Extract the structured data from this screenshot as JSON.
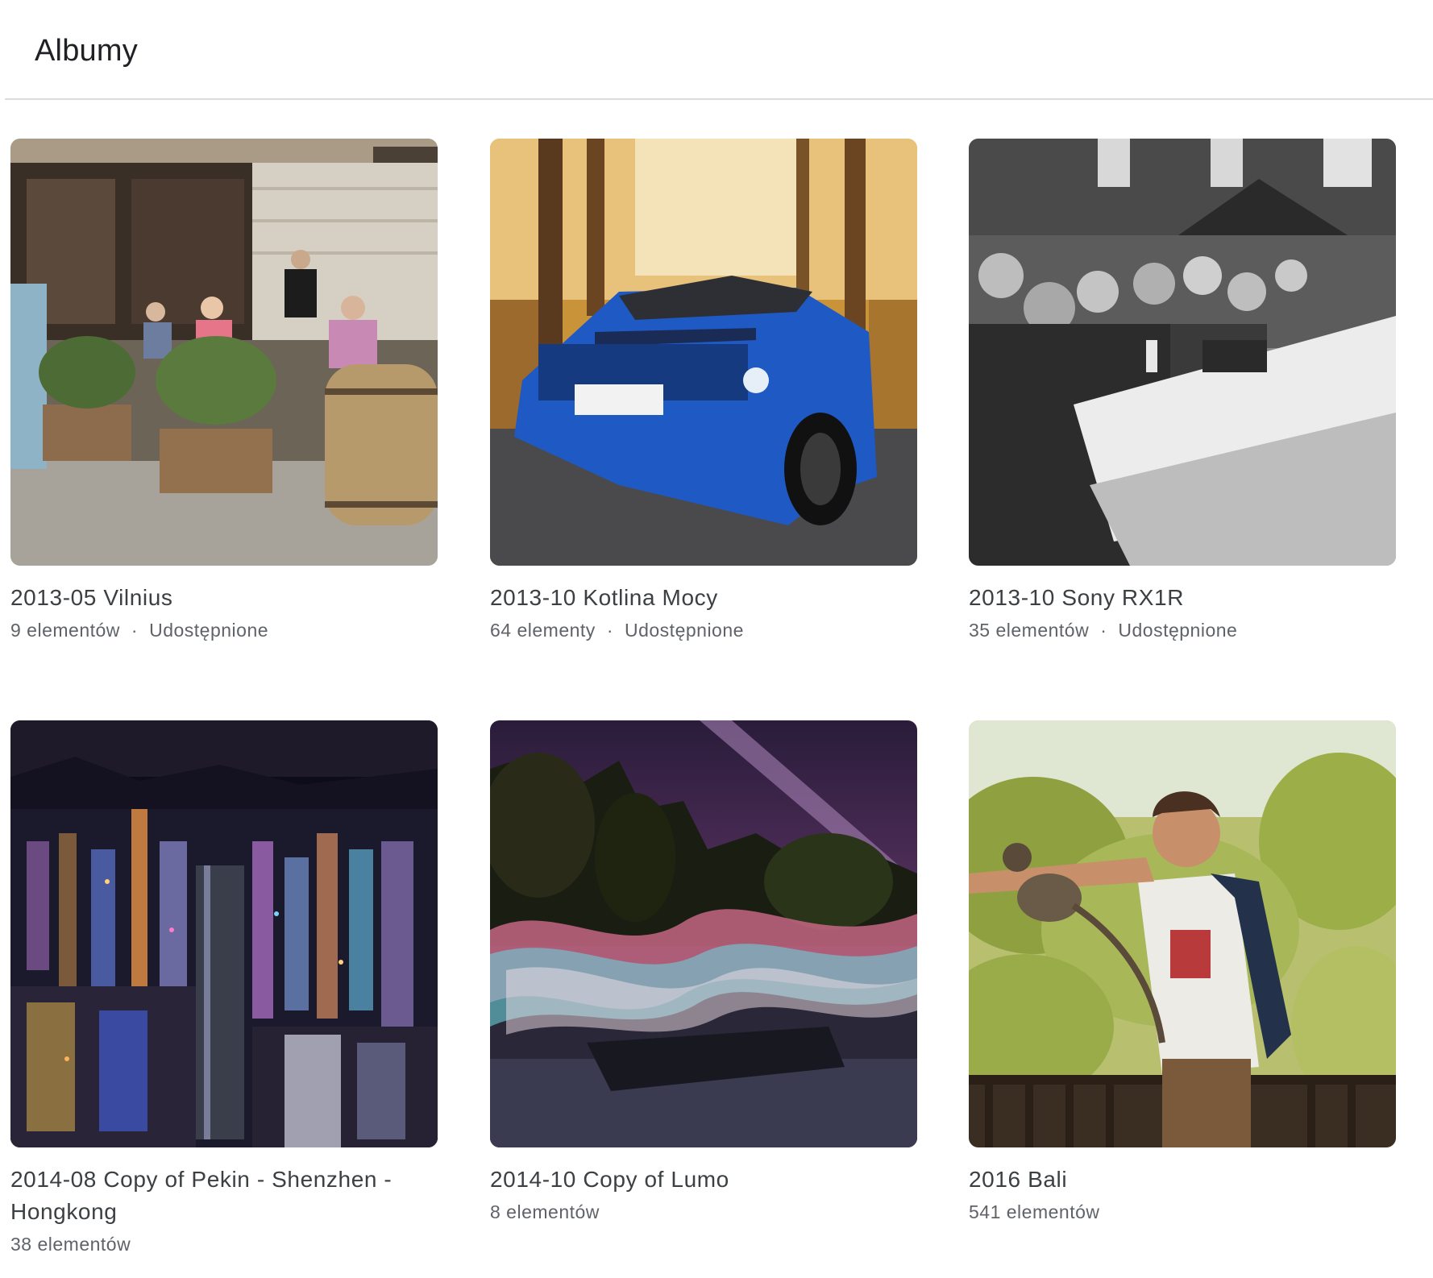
{
  "header": {
    "title": "Albumy"
  },
  "albums": [
    {
      "title": "2013-05 Vilnius",
      "count": "9 elementów",
      "separator": "·",
      "status": "Udostępnione",
      "thumbnail": "cafe-terrace-photo"
    },
    {
      "title": "2013-10 Kotlina Mocy",
      "count": "64 elementy",
      "separator": "·",
      "status": "Udostępnione",
      "thumbnail": "blue-car-photo"
    },
    {
      "title": "2013-10 Sony RX1R",
      "count": "35 elementów",
      "separator": "·",
      "status": "Udostępnione",
      "thumbnail": "bw-exhibition-photo"
    },
    {
      "title": "2014-08 Copy of Pekin - Shenzhen - Hongkong",
      "count": "38 elementów",
      "thumbnail": "night-city-photo"
    },
    {
      "title": "2014-10 Copy of Lumo",
      "count": "8 elementów",
      "thumbnail": "light-painting-photo"
    },
    {
      "title": "2016 Bali",
      "count": "541 elementów",
      "thumbnail": "man-with-monkey-photo"
    }
  ]
}
